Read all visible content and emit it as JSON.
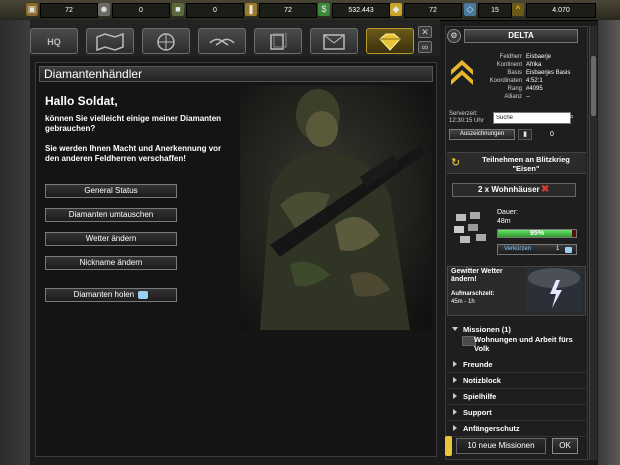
{
  "resources": [
    {
      "icon": "crate-icon",
      "value": "72"
    },
    {
      "icon": "soldier-icon",
      "value": "0"
    },
    {
      "icon": "tank-icon",
      "value": "0"
    },
    {
      "icon": "ammo-icon",
      "value": "72"
    },
    {
      "icon": "money-icon",
      "value": "532.443"
    },
    {
      "icon": "gold-icon",
      "value": "72"
    },
    {
      "icon": "diamond-icon",
      "value": "15"
    },
    {
      "icon": "rank-icon",
      "value": "4.070"
    }
  ],
  "nav": {
    "items": [
      "HQ",
      "map",
      "globe",
      "handshake",
      "docs",
      "mail",
      "diamond"
    ],
    "active": 6
  },
  "panel": {
    "title": "Diamantenhändler",
    "greeting": "Hallo Soldat,",
    "text1": "können Sie vielleicht einige meiner Diamanten gebrauchen?",
    "text2": "Sie werden Ihnen Macht und Anerkennung vor den anderen Feldherren verschaffen!",
    "buttons": [
      "General Status",
      "Diamanten umtauschen",
      "Wetter ändern",
      "Nickname ändern",
      "Diamanten holen"
    ]
  },
  "profile": {
    "name": "DELTA",
    "labels": [
      "Feldherr",
      "Kontinent",
      "Basis",
      "Koordinaten",
      "Rang",
      "Allianz"
    ],
    "values": [
      "Eisbaerje",
      "Afrika",
      "Eisbaerjes Basis",
      "4:52:1",
      "#4095",
      "--"
    ],
    "server_time_label": "Serverzeit:",
    "server_time": "12:30:15 Uhr",
    "search_value": "Suche",
    "awards_label": "Auszeichnungen",
    "awards_count": "0"
  },
  "blitzkrieg": {
    "label": "Teilnehmen an Blitzkrieg \"Eisen\""
  },
  "build": {
    "item": "2 x Wohnhäuser",
    "duration_label": "Dauer:",
    "duration": "48m",
    "progress_text": "95%",
    "progress": 0.95,
    "shorten_label": "Verkürzen",
    "shorten_cost": "1"
  },
  "weather": {
    "title": "Gewitter Wetter ändern!",
    "resume_label": "Aufmarschzeit:",
    "resume_value": "45m - 1h"
  },
  "sections": {
    "missions": "Missionen (1)",
    "mission_item": "Wohnungen und Arbeit fürs Volk",
    "list": [
      "Freunde",
      "Notizblock",
      "Spielhilfe",
      "Support",
      "Anfängerschutz"
    ]
  },
  "footer": {
    "new_missions": "10 neue Missionen",
    "ok": "OK"
  },
  "colors": {
    "accent": "#ffd83a",
    "progress": "#3ec13e",
    "danger": "#d23c2c"
  }
}
